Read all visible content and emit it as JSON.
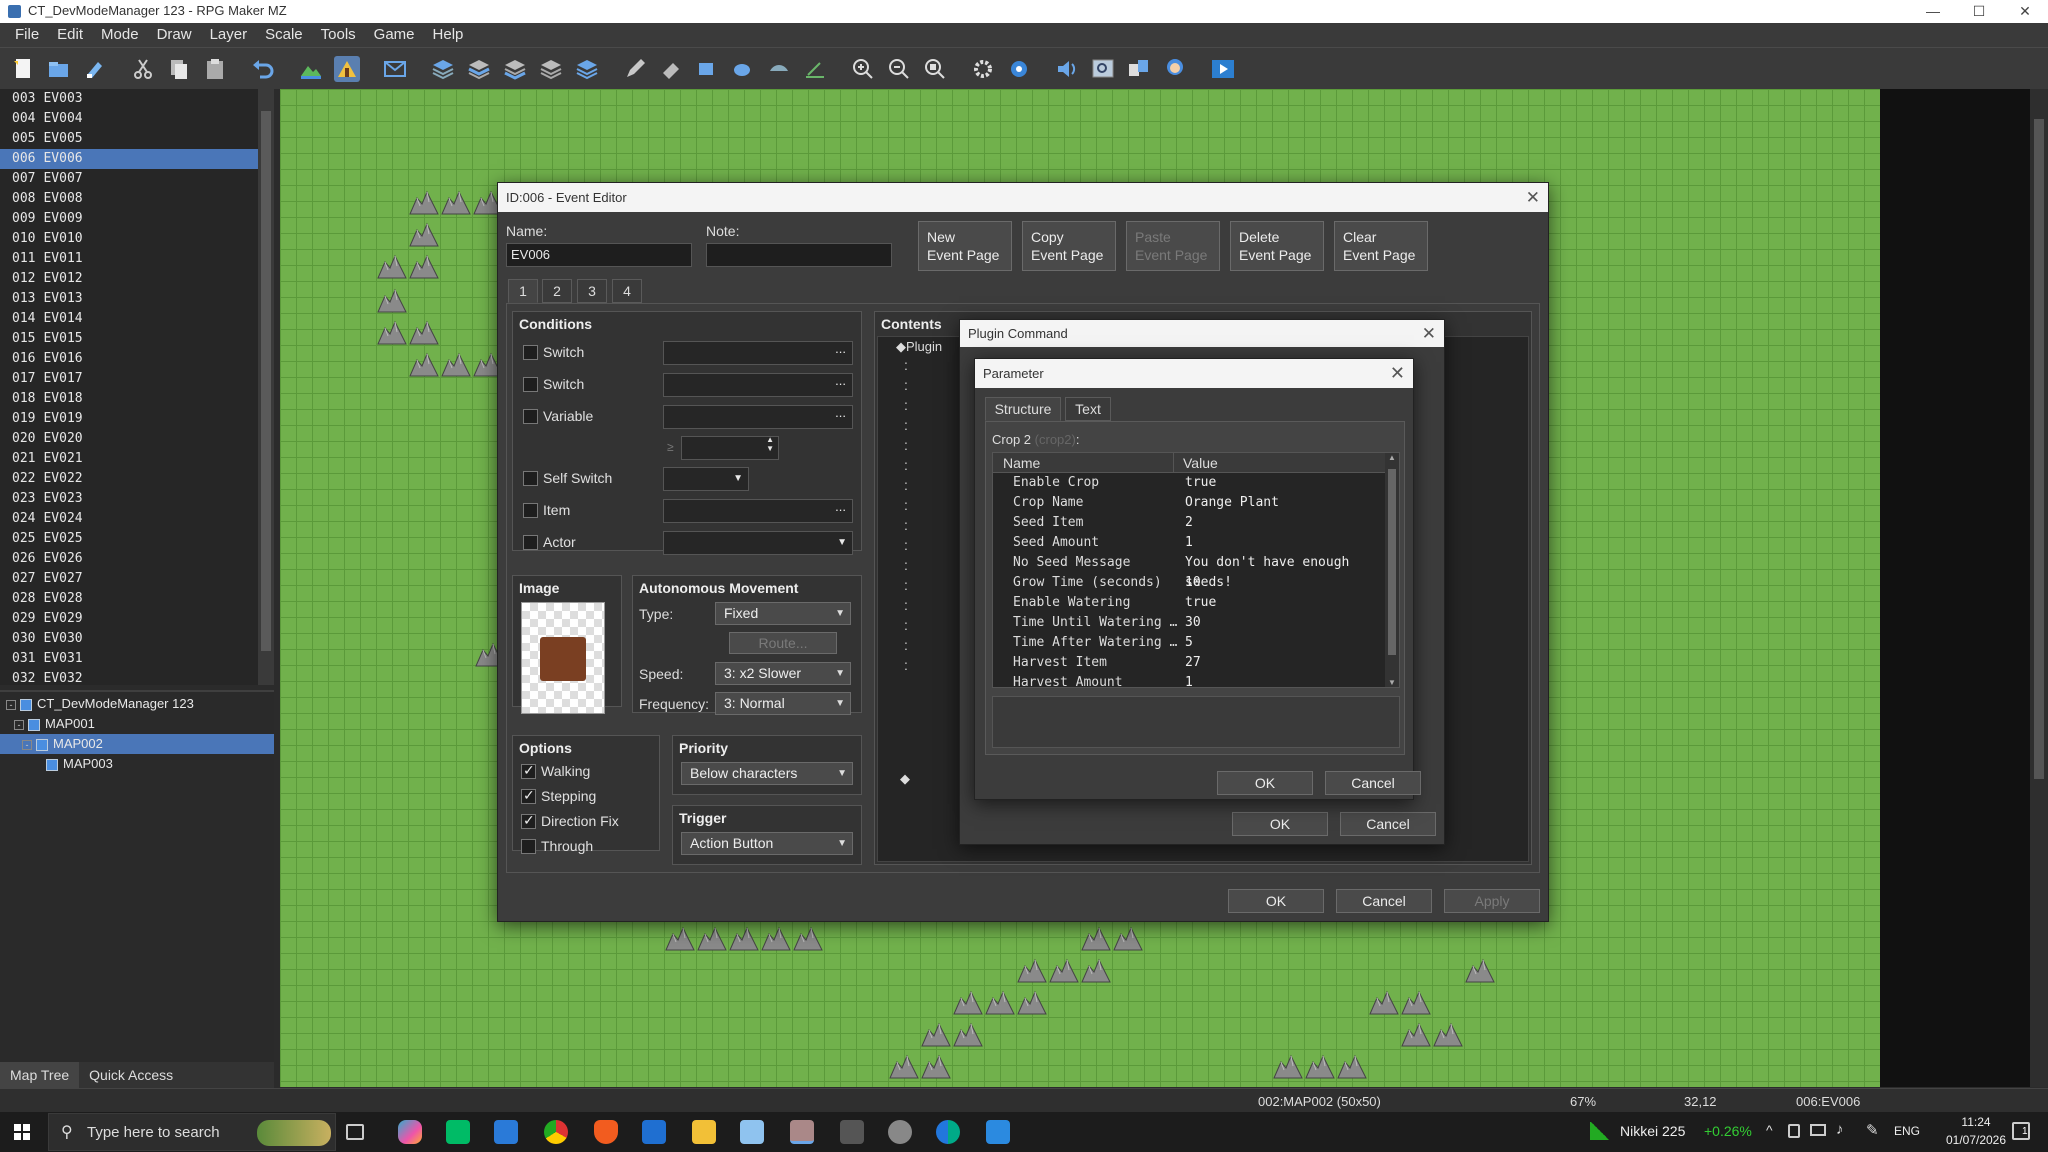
{
  "window": {
    "title": "CT_DevModeManager 123 - RPG Maker MZ",
    "min": "—",
    "max": "☐",
    "close": "✕"
  },
  "menu": [
    "File",
    "Edit",
    "Mode",
    "Draw",
    "Layer",
    "Scale",
    "Tools",
    "Game",
    "Help"
  ],
  "event_list": [
    {
      "id": "003",
      "name": "EV003"
    },
    {
      "id": "004",
      "name": "EV004"
    },
    {
      "id": "005",
      "name": "EV005"
    },
    {
      "id": "006",
      "name": "EV006"
    },
    {
      "id": "007",
      "name": "EV007"
    },
    {
      "id": "008",
      "name": "EV008"
    },
    {
      "id": "009",
      "name": "EV009"
    },
    {
      "id": "010",
      "name": "EV010"
    },
    {
      "id": "011",
      "name": "EV011"
    },
    {
      "id": "012",
      "name": "EV012"
    },
    {
      "id": "013",
      "name": "EV013"
    },
    {
      "id": "014",
      "name": "EV014"
    },
    {
      "id": "015",
      "name": "EV015"
    },
    {
      "id": "016",
      "name": "EV016"
    },
    {
      "id": "017",
      "name": "EV017"
    },
    {
      "id": "018",
      "name": "EV018"
    },
    {
      "id": "019",
      "name": "EV019"
    },
    {
      "id": "020",
      "name": "EV020"
    },
    {
      "id": "021",
      "name": "EV021"
    },
    {
      "id": "022",
      "name": "EV022"
    },
    {
      "id": "023",
      "name": "EV023"
    },
    {
      "id": "024",
      "name": "EV024"
    },
    {
      "id": "025",
      "name": "EV025"
    },
    {
      "id": "026",
      "name": "EV026"
    },
    {
      "id": "027",
      "name": "EV027"
    },
    {
      "id": "028",
      "name": "EV028"
    },
    {
      "id": "029",
      "name": "EV029"
    },
    {
      "id": "030",
      "name": "EV030"
    },
    {
      "id": "031",
      "name": "EV031"
    },
    {
      "id": "032",
      "name": "EV032"
    }
  ],
  "map_tree": {
    "project": "CT_DevModeManager 123",
    "items": [
      "MAP001",
      "MAP002",
      "MAP003"
    ]
  },
  "bottom_tabs": [
    "Map Tree",
    "Quick Access"
  ],
  "status": {
    "map": "002:MAP002 (50x50)",
    "zoom": "67%",
    "coords": "32,12",
    "event": "006:EV006"
  },
  "taskbar": {
    "search_placeholder": "Type here to search",
    "stock_name": "Nikkei 225",
    "stock_change": "+0.26%",
    "lang": "ENG",
    "time": "11:24",
    "date": "01/07/2026",
    "notifications": "1"
  },
  "event_editor": {
    "title": "ID:006 - Event Editor",
    "name_label": "Name:",
    "name_value": "EV006",
    "note_label": "Note:",
    "note_value": "",
    "page_buttons": [
      {
        "line1": "New",
        "line2": "Event Page"
      },
      {
        "line1": "Copy",
        "line2": "Event Page"
      },
      {
        "line1": "Paste",
        "line2": "Event Page"
      },
      {
        "line1": "Delete",
        "line2": "Event Page"
      },
      {
        "line1": "Clear",
        "line2": "Event Page"
      }
    ],
    "page_tabs": [
      "1",
      "2",
      "3",
      "4"
    ],
    "conditions": {
      "title": "Conditions",
      "rows": [
        {
          "label": "Switch",
          "value": "",
          "more": "..."
        },
        {
          "label": "Switch",
          "value": "",
          "more": "..."
        },
        {
          "label": "Variable",
          "value": "",
          "more": "..."
        },
        {
          "label": "Self Switch",
          "value": ""
        },
        {
          "label": "Item",
          "value": "",
          "more": "..."
        },
        {
          "label": "Actor",
          "value": ""
        }
      ],
      "ge_symbol": "≥"
    },
    "image": {
      "title": "Image"
    },
    "movement": {
      "title": "Autonomous Movement",
      "type_label": "Type:",
      "type_value": "Fixed",
      "route_button": "Route...",
      "speed_label": "Speed:",
      "speed_value": "3: x2 Slower",
      "freq_label": "Frequency:",
      "freq_value": "3: Normal"
    },
    "options": {
      "title": "Options",
      "items": [
        {
          "label": "Walking",
          "checked": true
        },
        {
          "label": "Stepping",
          "checked": true
        },
        {
          "label": "Direction Fix",
          "checked": true
        },
        {
          "label": "Through",
          "checked": false
        }
      ]
    },
    "priority": {
      "title": "Priority",
      "value": "Below characters"
    },
    "trigger": {
      "title": "Trigger",
      "value": "Action Button"
    },
    "contents": {
      "title": "Contents",
      "first_line": "◆Plugin",
      "end_marker": "◆"
    },
    "ok": "OK",
    "cancel": "Cancel",
    "apply": "Apply"
  },
  "plugin_command": {
    "title": "Plugin Command",
    "ok": "OK",
    "cancel": "Cancel"
  },
  "parameter": {
    "title": "Parameter",
    "tabs": [
      "Structure",
      "Text"
    ],
    "struct_label": "Crop 2",
    "struct_hint": "(crop2)",
    "struct_colon": ":",
    "columns": [
      "Name",
      "Value"
    ],
    "rows": [
      {
        "name": "Enable Crop",
        "value": "true"
      },
      {
        "name": "Crop Name",
        "value": "Orange Plant"
      },
      {
        "name": "Seed Item",
        "value": "2"
      },
      {
        "name": "Seed Amount",
        "value": "1"
      },
      {
        "name": "No Seed Message",
        "value": "You don't have enough seeds!"
      },
      {
        "name": "Grow Time (seconds)",
        "value": "10"
      },
      {
        "name": "Enable Watering",
        "value": "true"
      },
      {
        "name": "Time Until Watering …",
        "value": "30"
      },
      {
        "name": "Time After Watering …",
        "value": "5"
      },
      {
        "name": "Harvest Item",
        "value": "27"
      },
      {
        "name": "Harvest Amount",
        "value": "1"
      }
    ],
    "ok": "OK",
    "cancel": "Cancel"
  }
}
